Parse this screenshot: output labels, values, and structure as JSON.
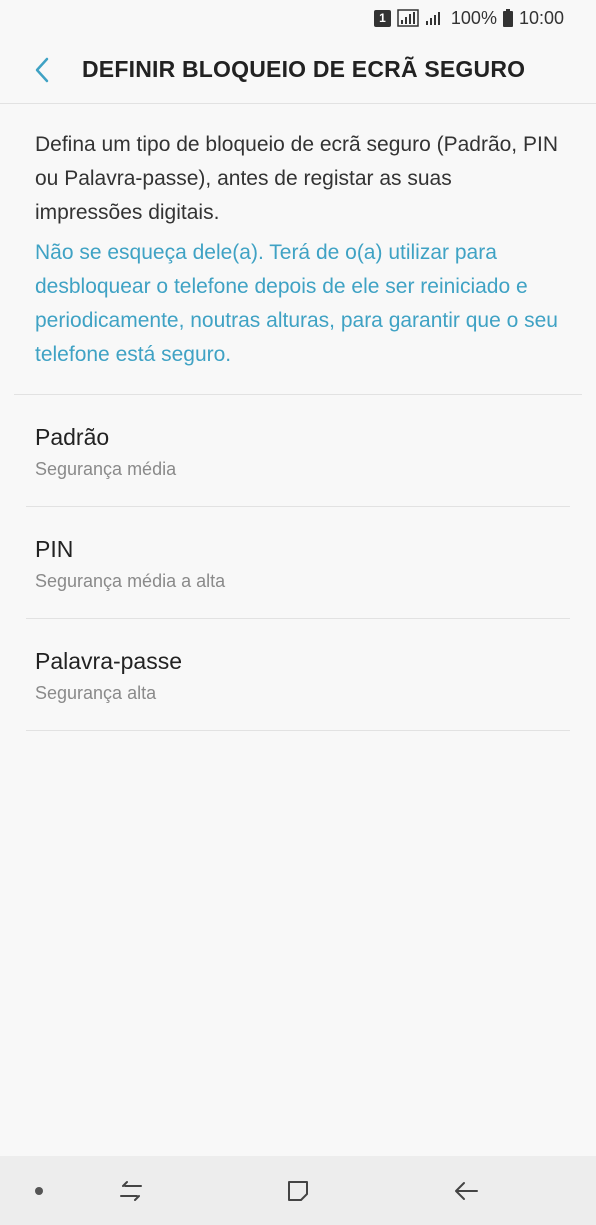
{
  "status_bar": {
    "sim_label": "1",
    "battery": "100%",
    "time": "10:00",
    "icons": [
      "sim-icon",
      "signal-icon",
      "signal-icon",
      "battery-icon"
    ]
  },
  "header": {
    "title": "DEFINIR BLOQUEIO DE ECRÃ SEGURO",
    "back_icon": "chevron-left-icon"
  },
  "description": {
    "main": "Defina um tipo de bloqueio de ecrã seguro (Padrão, PIN ou Palavra-passe), antes de registar as suas impressões digitais.",
    "note": "Não se esqueça dele(a). Terá de o(a) utilizar para desbloquear o telefone depois de ele ser reiniciado e periodicamente, noutras alturas, para garantir que o seu telefone está seguro."
  },
  "options": [
    {
      "title": "Padrão",
      "subtitle": "Segurança média"
    },
    {
      "title": "PIN",
      "subtitle": "Segurança média a alta"
    },
    {
      "title": "Palavra-passe",
      "subtitle": "Segurança alta"
    }
  ],
  "nav_bar": {
    "icons": [
      "dot-icon",
      "recents-icon",
      "home-icon",
      "back-arrow-icon"
    ]
  },
  "colors": {
    "accent": "#3fa2c4",
    "background": "#f8f8f8",
    "text": "#222222",
    "subtext": "#8a8a8a"
  }
}
